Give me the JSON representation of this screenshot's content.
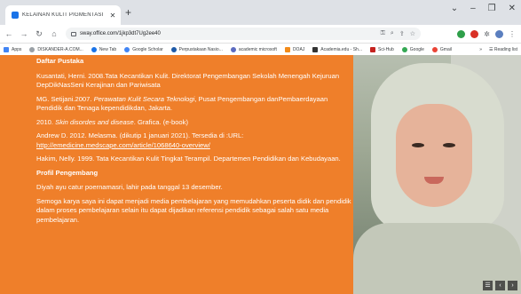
{
  "browser": {
    "tab_title": "KELAINAN KULIT PIGMENTASI",
    "url": "sway.office.com/1jkp3dt7Ug2ee40",
    "bookmarks": [
      "Apps",
      "DISKANDER-A.COM...",
      "New Tab",
      "Google Scholar",
      "Perpustakaan Nasio...",
      "academic microsoft",
      "DOAJ",
      "Academia.edu - Sh...",
      "Sci-Hub",
      "Google",
      "Gmail"
    ],
    "reading_list": "Reading list",
    "bookmarks_overflow": "»"
  },
  "content": {
    "references_heading": "Daftar Pustaka",
    "ref1": "Kusantati, Herni. 2008.Tata Kecantikan Kulit. Direktorat Pengembangan Sekolah Menengah Kejuruan DepDikNasSeni Kerajinan dan Pariwisata",
    "ref2_a": "MG. Setijani.2007. ",
    "ref2_b": "Perawatan Kulit Secara Teknologi",
    "ref2_c": ", Pusat Pengembangan danPembaerdayaan Pendidik dan Tenaga kependidikdan, Jakarta.",
    "ref3_a": "2010. ",
    "ref3_b": "Skin disordes and disease",
    "ref3_c": ". Grafica.  (e-book)",
    "ref4_a": "Andrew D. 2012. Melasma. (dikutip 1 januari 2021). Tersedia di :URL: ",
    "ref4_link": "http://emedicine.medscape.com/article/1068640-overview/",
    "ref5": "Hakim, Nelly. 1999. Tata Kecantikan Kulit Tingkat Terampil. Departemen Pendidikan dan Kebudayaan.",
    "profile_heading": "Profil Pengembang",
    "profile1": "Diyah ayu catur poernamasri, lahir pada tanggal 13 desember.",
    "profile2": "Semoga karya saya ini dapat menjadi media pembelajaran yang memudahkan peserta didik dan pendidik dalam proses pembelajaran selain itu dapat dijadikan referensi pendidik sebagai salah satu media pembelajaran."
  },
  "colors": {
    "background": "#ef7f2a",
    "text": "#ffffff"
  }
}
